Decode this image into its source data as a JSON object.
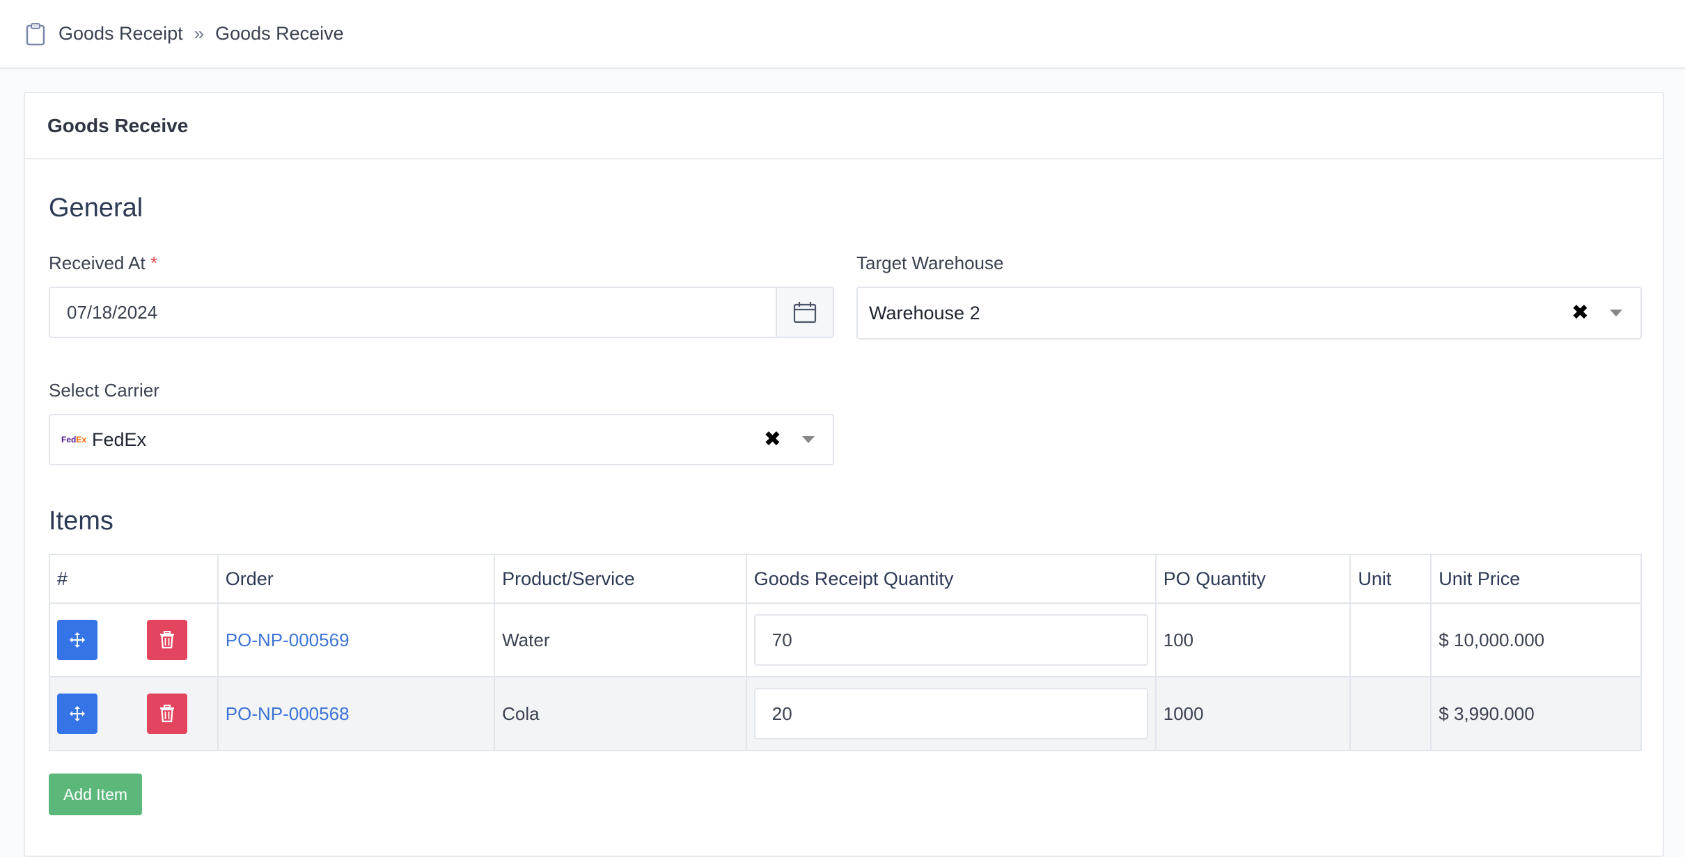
{
  "breadcrumb": {
    "icon": "clipboard-icon",
    "items": [
      "Goods Receipt",
      "Goods Receive"
    ],
    "separator": "»"
  },
  "card": {
    "title": "Goods Receive"
  },
  "general": {
    "heading": "General",
    "received_at": {
      "label": "Received At",
      "required_mark": "*",
      "value": "07/18/2024",
      "icon": "calendar-icon"
    },
    "target_warehouse": {
      "label": "Target Warehouse",
      "value": "Warehouse 2",
      "clear": "✖"
    },
    "carrier": {
      "label": "Select Carrier",
      "logo_fed": "Fed",
      "logo_ex": "Ex",
      "value": "FedEx",
      "clear": "✖"
    }
  },
  "items": {
    "heading": "Items",
    "columns": [
      "#",
      "Order",
      "Product/Service",
      "Goods Receipt Quantity",
      "PO Quantity",
      "Unit",
      "Unit Price"
    ],
    "rows": [
      {
        "order": "PO-NP-000569",
        "product": "Water",
        "gr_qty": "70",
        "po_qty": "100",
        "unit": "",
        "unit_price": "$ 10,000.000"
      },
      {
        "order": "PO-NP-000568",
        "product": "Cola",
        "gr_qty": "20",
        "po_qty": "1000",
        "unit": "",
        "unit_price": "$ 3,990.000"
      }
    ],
    "add_button": "Add Item"
  },
  "colors": {
    "primary": "#3474e6",
    "danger": "#e4455e",
    "success": "#5cb87a",
    "link": "#3d74d6"
  }
}
